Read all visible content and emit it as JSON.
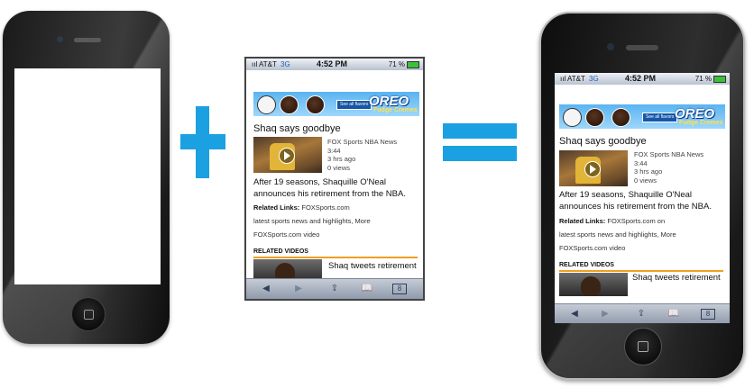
{
  "colors": {
    "accent": "#1ba0e2",
    "orange_rule": "#f0a020"
  },
  "status_bar": {
    "carrier": "ııl AT&T",
    "network": "3G",
    "time": "4:52 PM",
    "battery": "71 %"
  },
  "ad": {
    "see_all": "See all flavors",
    "brand": "OREO",
    "subbrand": "Fudge Cremes"
  },
  "article": {
    "headline": "Shaq says goodbye",
    "source": "FOX Sports NBA News",
    "duration": "3:44",
    "age": "3 hrs ago",
    "views": "0 views",
    "description": "After 19 seasons, Shaquille O'Neal announces his retirement from the NBA.",
    "related_links_label": "Related Links:",
    "related_links_mid_line1": "FOXSports.com",
    "related_links_mid_line2": "latest sports news and highlights, More",
    "related_links_mid_line3": "FOXSports.com video",
    "related_links_right_line1": "FOXSports.com on",
    "related_links_right_line2": "latest sports news and highlights, More",
    "related_links_right_line3": "FOXSports.com video"
  },
  "related_videos": {
    "header": "RELATED VIDEOS",
    "first_title": "Shaq tweets retirement"
  },
  "toolbar": {
    "back_icon": "◀",
    "forward_icon": "▶",
    "share_icon": "⇪",
    "bookmarks_icon": "📖",
    "pages_icon": "8"
  }
}
